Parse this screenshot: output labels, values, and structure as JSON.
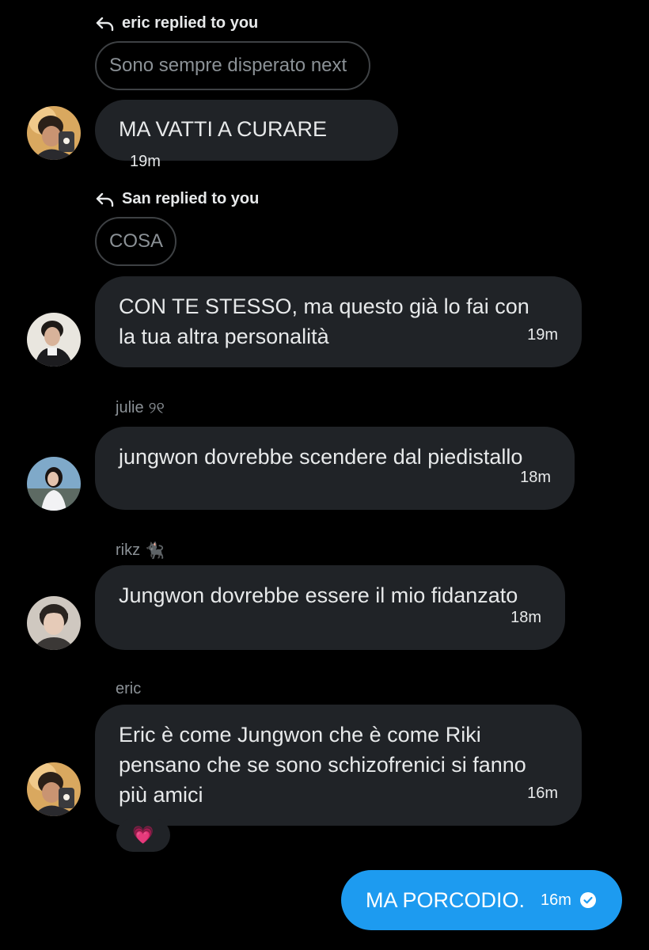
{
  "messages": [
    {
      "reply_header": "eric replied to you",
      "quoted_text": "Sono sempre disperato next",
      "text": "MA VATTI A CURARE",
      "time": "19m",
      "avatar": "eric-avatar"
    },
    {
      "reply_header": "San replied to you",
      "quoted_text": "COSA",
      "text": "CON TE STESSO, ma questo già lo fai con\nla tua altra personalità",
      "time": "19m",
      "avatar": "san-avatar"
    },
    {
      "sender": "julie",
      "sender_emoji": "୨୧",
      "text": "jungwon dovrebbe scendere dal piedistallo",
      "time": "18m",
      "avatar": "julie-avatar"
    },
    {
      "sender": "rikz",
      "sender_emoji": "🐈‍⬛",
      "text": "Jungwon dovrebbe essere il mio fidanzato",
      "time": "18m",
      "avatar": "rikz-avatar"
    },
    {
      "sender": "eric",
      "text": "Eric è come Jungwon che è come Riki\npensano che se sono schizofrenici si fanno\npiù amici",
      "time": "16m",
      "avatar": "eric-avatar",
      "reaction": "💗"
    }
  ],
  "own_message": {
    "text": "MA PORCODIO.",
    "time": "16m",
    "status_icon": "check-circle-icon"
  },
  "colors": {
    "background": "#000000",
    "bubble": "#202327",
    "own_bubble": "#1d9bf0",
    "muted_text": "#8b9196",
    "text": "#e7e9ea"
  }
}
